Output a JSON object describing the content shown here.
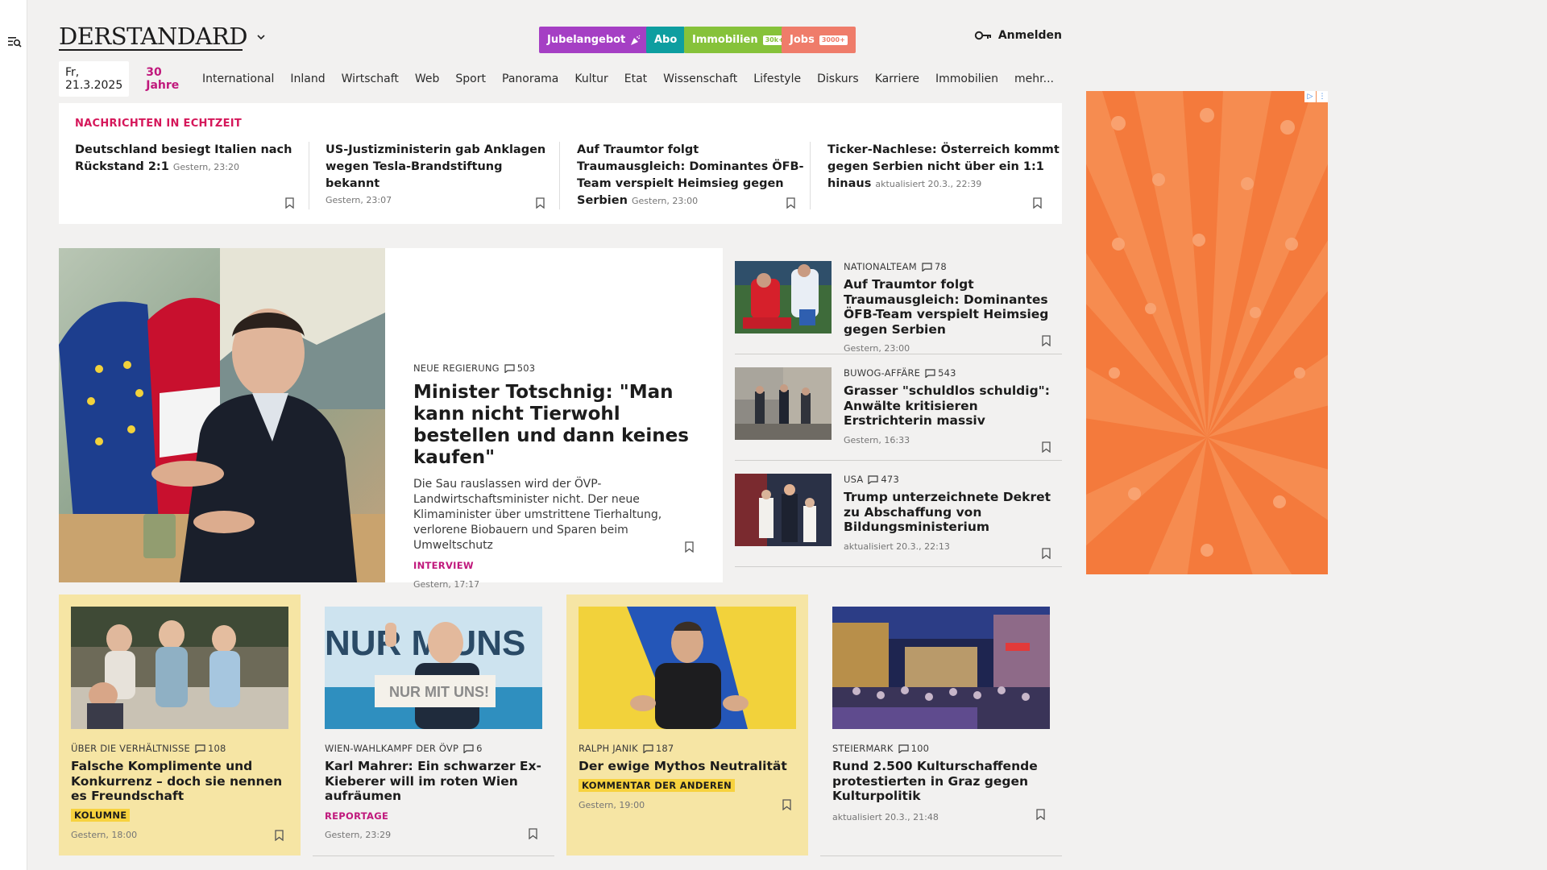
{
  "brand": {
    "logo": "DERSTANDARD"
  },
  "header": {
    "promos": [
      {
        "label": "Jubelangebot",
        "color": "#a53fc4"
      },
      {
        "label": "Abo",
        "color": "#0e9ea0"
      },
      {
        "label": "Immobilien",
        "tag": "30k+",
        "color": "#86c23a"
      },
      {
        "label": "Jobs",
        "tag": "3000+",
        "color": "#ef7c6a"
      }
    ],
    "login_label": "Anmelden"
  },
  "nav": {
    "date": "Fr, 21.3.2025",
    "items": [
      "30 Jahre",
      "International",
      "Inland",
      "Wirtschaft",
      "Web",
      "Sport",
      "Panorama",
      "Kultur",
      "Etat",
      "Wissenschaft",
      "Lifestyle",
      "Diskurs",
      "Karriere",
      "Immobilien",
      "mehr..."
    ]
  },
  "ticker": {
    "label": "NACHRICHTEN IN ECHTZEIT",
    "items": [
      {
        "title": "Deutschland besiegt Italien nach Rückstand 2:1",
        "time": "Gestern, 23:20"
      },
      {
        "title": "US-Justizministerin gab Anklagen wegen Tesla-Brandstiftung bekannt",
        "time": "Gestern, 23:07"
      },
      {
        "title": "Auf Traumtor folgt Traumausgleich: Dominantes ÖFB-Team verspielt Heimsieg gegen Serbien",
        "time": "Gestern, 23:00"
      },
      {
        "title": "Ticker-Nachlese: Österreich kommt gegen Serbien nicht über ein 1:1 hinaus",
        "time": "aktualisiert 20.3., 22:39"
      }
    ]
  },
  "lead": {
    "kicker": "NEUE REGIERUNG",
    "comments": "503",
    "title": "Minister Totschnig: \"Man kann nicht Tierwohl bestellen und dann keines kaufen\"",
    "teaser": "Die Sau rauslassen wird der ÖVP-Landwirtschaftsminister nicht. Der neue Klimaminister über umstrittene Tierhaltung, verlorene Biobauern und Sparen beim Umweltschutz",
    "tag": "INTERVIEW",
    "tag_color": "#c0187c",
    "time": "Gestern, 17:17"
  },
  "side": [
    {
      "kicker": "NATIONALTEAM",
      "comments": "78",
      "title": "Auf Traumtor folgt Traumausgleich: Dominantes ÖFB-Team verspielt Heimsieg gegen Serbien",
      "time": "Gestern, 23:00"
    },
    {
      "kicker": "BUWOG-AFFÄRE",
      "comments": "543",
      "title": "Grasser \"schuldlos schuldig\": Anwälte kritisieren Erstrichterin massiv",
      "time": "Gestern, 16:33"
    },
    {
      "kicker": "USA",
      "comments": "473",
      "title": "Trump unterzeichnete Dekret zu Abschaffung von Bildungsministerium",
      "time": "aktualisiert 20.3., 22:13"
    }
  ],
  "cards": [
    {
      "kicker": "ÜBER DIE VERHÄLTNISSE",
      "comments": "108",
      "title": "Falsche Komplimente und Konkurrenz – doch sie nennen es Freundschaft",
      "tag": "KOLUMNE",
      "time": "Gestern, 18:00"
    },
    {
      "kicker": "WIEN-WAHLKAMPF DER ÖVP",
      "comments": "6",
      "title": "Karl Mahrer: Ein schwarzer Ex-Kieberer will im roten Wien aufräumen",
      "tag": "REPORTAGE",
      "tag_color": "#c0187c",
      "time": "Gestern, 23:29",
      "image_text": "NUR MIT UNS!",
      "image_bg_text": "NUR M UNS"
    },
    {
      "kicker": "RALPH JANIK",
      "comments": "187",
      "title": "Der ewige Mythos Neutralität",
      "tag": "KOMMENTAR DER ANDEREN",
      "time": "Gestern, 19:00"
    },
    {
      "kicker": "STEIERMARK",
      "comments": "100",
      "title": "Rund 2.500 Kulturschaffende protestierten in Graz gegen Kulturpolitik",
      "time": "aktualisiert 20.3., 21:48"
    }
  ]
}
